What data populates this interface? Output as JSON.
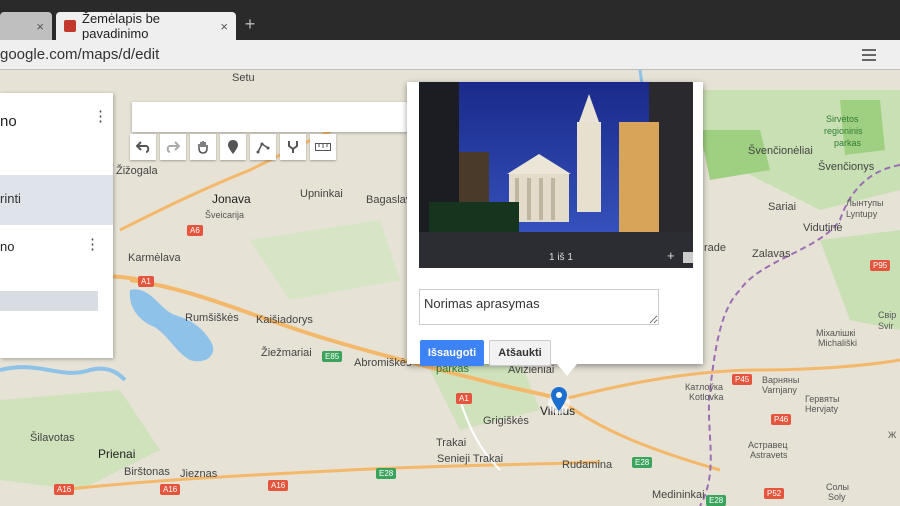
{
  "browser": {
    "tab_active_title": "Žemėlapis be pavadinimo",
    "tab_close": "×",
    "new_tab": "+",
    "url": "google.com/maps/d/edit"
  },
  "left_panel": {
    "title": "no",
    "item_selected": "rinti",
    "layer_label": "no",
    "more": "⋮"
  },
  "search": {
    "placeholder": "",
    "button_icon": "search-icon"
  },
  "toolbar": {
    "tools": [
      "undo-icon",
      "redo-icon",
      "hand-icon",
      "marker-icon",
      "line-icon",
      "directions-icon",
      "ruler-icon"
    ]
  },
  "popup": {
    "photo_counter": "1 iš 1",
    "photo_add": "+",
    "description_value": "Norimas aprasymas",
    "save_label": "Išsaugoti",
    "cancel_label": "Atšaukti"
  },
  "map_labels": {
    "setu": "Setu",
    "zizogala": "Žižogala",
    "jonava": "Jonava",
    "sveicarija": "Šveicarija",
    "upninkai": "Upninkai",
    "bagaslaviskis": "Bagaslav",
    "karmelava": "Karmėlava",
    "rumsiskes": "Rumšiškės",
    "kaisiadorys": "Kaišiadorys",
    "ziezmariai": "Žiežmariai",
    "abromiskes": "Abromiškės",
    "parkas": "parkas",
    "avizieniai": "Avižieniai",
    "vilnius": "Vilnius",
    "grigiskes": "Grigiškės",
    "trakai": "Trakai",
    "seneji_trakai": "Senieji Trakai",
    "rudamina": "Rudamina",
    "silavotas": "Šilavotas",
    "prienai": "Prienai",
    "birstonas": "Birštonas",
    "jieznas": "Jieznas",
    "medininkai": "Medininkai",
    "svencioneliai": "Švenčionėliai",
    "svencionys": "Švenčionys",
    "sirvetos": "Sirvėtos",
    "regioninis": "regioninis",
    "parkas2": "parkas",
    "sariai": "Sariai",
    "lyntupy_ru": "Лынтупы",
    "lyntupy": "Lyntupy",
    "vidutine": "Vidutinė",
    "zalavas": "Zalavas",
    "rade": "rade",
    "svir_ru": "Свір",
    "svir": "Svir",
    "michalishki_ru": "Міхалішкі",
    "michaliski": "Michališki",
    "katluoka_ru": "Катлоўка",
    "kotlovka": "Kotlovka",
    "varnjany_ru": "Варняны",
    "varnjany": "Varnjany",
    "gervjaty_ru": "Гервяты",
    "gervjaty": "Hervjaty",
    "astraviec_ru": "Астравец",
    "astraviec": "Astravets",
    "soly_ru": "Солы",
    "soly": "Soly",
    "zh_ru": "Ж"
  },
  "roads": {
    "a6": "A6",
    "a1": "A1",
    "a1b": "A1",
    "a16a": "A16",
    "a16b": "A16",
    "a16c": "A16",
    "e85": "E85",
    "e28a": "E28",
    "e28b": "E28",
    "e28c": "E28",
    "p45": "P45",
    "p46": "P46",
    "p52": "P52",
    "p95": "P95"
  },
  "colors": {
    "accent": "#3e82f7",
    "map_bg": "#e6e2d6",
    "water": "#8ec2e8",
    "forest": "#c5dfb1"
  }
}
